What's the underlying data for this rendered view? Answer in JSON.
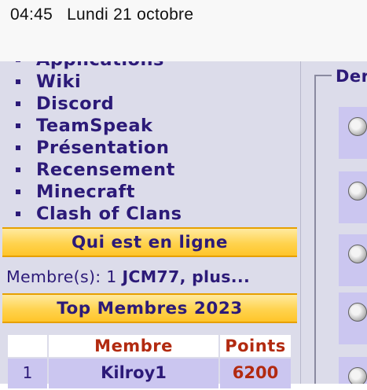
{
  "status_bar": {
    "time": "04:45",
    "date": "Lundi 21 octobre"
  },
  "sidebar": {
    "nav_items": [
      {
        "label": "Applications"
      },
      {
        "label": "Wiki"
      },
      {
        "label": "Discord"
      },
      {
        "label": "TeamSpeak"
      },
      {
        "label": "Présentation"
      },
      {
        "label": "Recensement"
      },
      {
        "label": "Minecraft"
      },
      {
        "label": "Clash of Clans"
      }
    ],
    "online": {
      "header": "Qui est en ligne",
      "members_label": "Membre(s): 1",
      "member": "JCM77",
      "more": ", plus..."
    },
    "top_members": {
      "header": "Top Membres 2023",
      "columns": [
        "",
        "Membre",
        "Points"
      ],
      "rows": [
        {
          "rank": "1",
          "member": "Kilroy1",
          "points": "6200"
        }
      ]
    }
  },
  "right_panel": {
    "legend": "Der"
  },
  "colors": {
    "link": "#2c1a78",
    "header_gold": "#ffd34e",
    "points_red": "#b22a10",
    "panel_bg": "#dcdcea",
    "row_bg": "#cbc6f0"
  }
}
